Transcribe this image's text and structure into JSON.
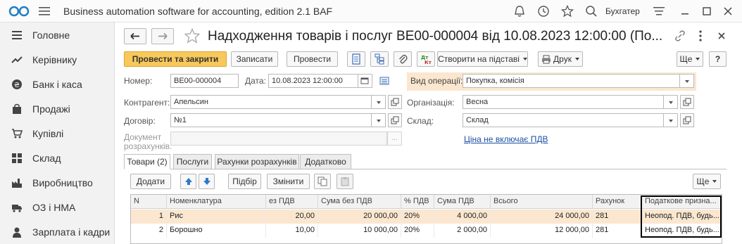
{
  "app": {
    "title": "Business automation software for accounting, edition 2.1 BAF",
    "user": "Бухгатер"
  },
  "sidebar": {
    "items": [
      {
        "label": "Головне",
        "icon": "menu-lines-icon"
      },
      {
        "label": "Керівнику",
        "icon": "trend-icon"
      },
      {
        "label": "Банк і каса",
        "icon": "coin-icon"
      },
      {
        "label": "Продажі",
        "icon": "bag-icon"
      },
      {
        "label": "Купівлі",
        "icon": "cart-icon"
      },
      {
        "label": "Склад",
        "icon": "grid-icon"
      },
      {
        "label": "Виробництво",
        "icon": "factory-icon"
      },
      {
        "label": "ОЗ і НМА",
        "icon": "truck-icon"
      },
      {
        "label": "Зарплата і кадри",
        "icon": "person-icon"
      }
    ]
  },
  "document": {
    "title": "Надходження товарів і послуг ВЕ00-000004 від 10.08.2023 12:00:00 (По..."
  },
  "toolbar": {
    "post_close": "Провести та закрити",
    "save": "Записати",
    "post": "Провести",
    "create_based": "Створити на підставі",
    "print": "Друк",
    "more": "Ще",
    "help": "?"
  },
  "form": {
    "number_label": "Номер:",
    "number": "ВЕ00-000004",
    "date_label": "Дата:",
    "date": "10.08.2023 12:00:00",
    "operation_label": "Вид операції:",
    "operation": "Покупка, комісія",
    "counterparty_label": "Контрагент:",
    "counterparty": "Апельсин",
    "organization_label": "Організація:",
    "organization": "Весна",
    "contract_label": "Договір:",
    "contract": "№1",
    "warehouse_label": "Склад:",
    "warehouse": "Склад",
    "settlement_label_1": "Документ",
    "settlement_label_2": "розрахунків:",
    "settlement_value": "...",
    "vat_link": "Ціна не включає ПДВ"
  },
  "tabs": [
    {
      "label": "Товари (2)",
      "active": true
    },
    {
      "label": "Послуги",
      "active": false
    },
    {
      "label": "Рахунки розрахунків",
      "active": false
    },
    {
      "label": "Додатково",
      "active": false
    }
  ],
  "table_toolbar": {
    "add": "Додати",
    "select": "Підбір",
    "change": "Змінити",
    "more": "Ще"
  },
  "table": {
    "columns": [
      "N",
      "Номенклатура",
      "ез ПДВ",
      "Сума без ПДВ",
      "% ПДВ",
      "Сума ПДВ",
      "Всього",
      "Рахунок",
      "Податкове призна..."
    ],
    "rows": [
      {
        "n": "1",
        "item": "Рис",
        "price": "20,00",
        "sum": "20 000,00",
        "vat_rate": "20%",
        "vat_sum": "4 000,00",
        "total": "24 000,00",
        "account": "281",
        "tax": "Неопод. ПДВ, будь..."
      },
      {
        "n": "2",
        "item": "Борошно",
        "price": "10,00",
        "sum": "10 000,00",
        "vat_rate": "20%",
        "vat_sum": "2 000,00",
        "total": "12 000,00",
        "account": "281",
        "tax": "Неопод. ПДВ, будь..."
      }
    ]
  },
  "colors": {
    "primary_button": "#f8c95a",
    "highlight": "#fbe7cf",
    "link": "#1b4fa3",
    "logo": "#1f7fc4"
  }
}
